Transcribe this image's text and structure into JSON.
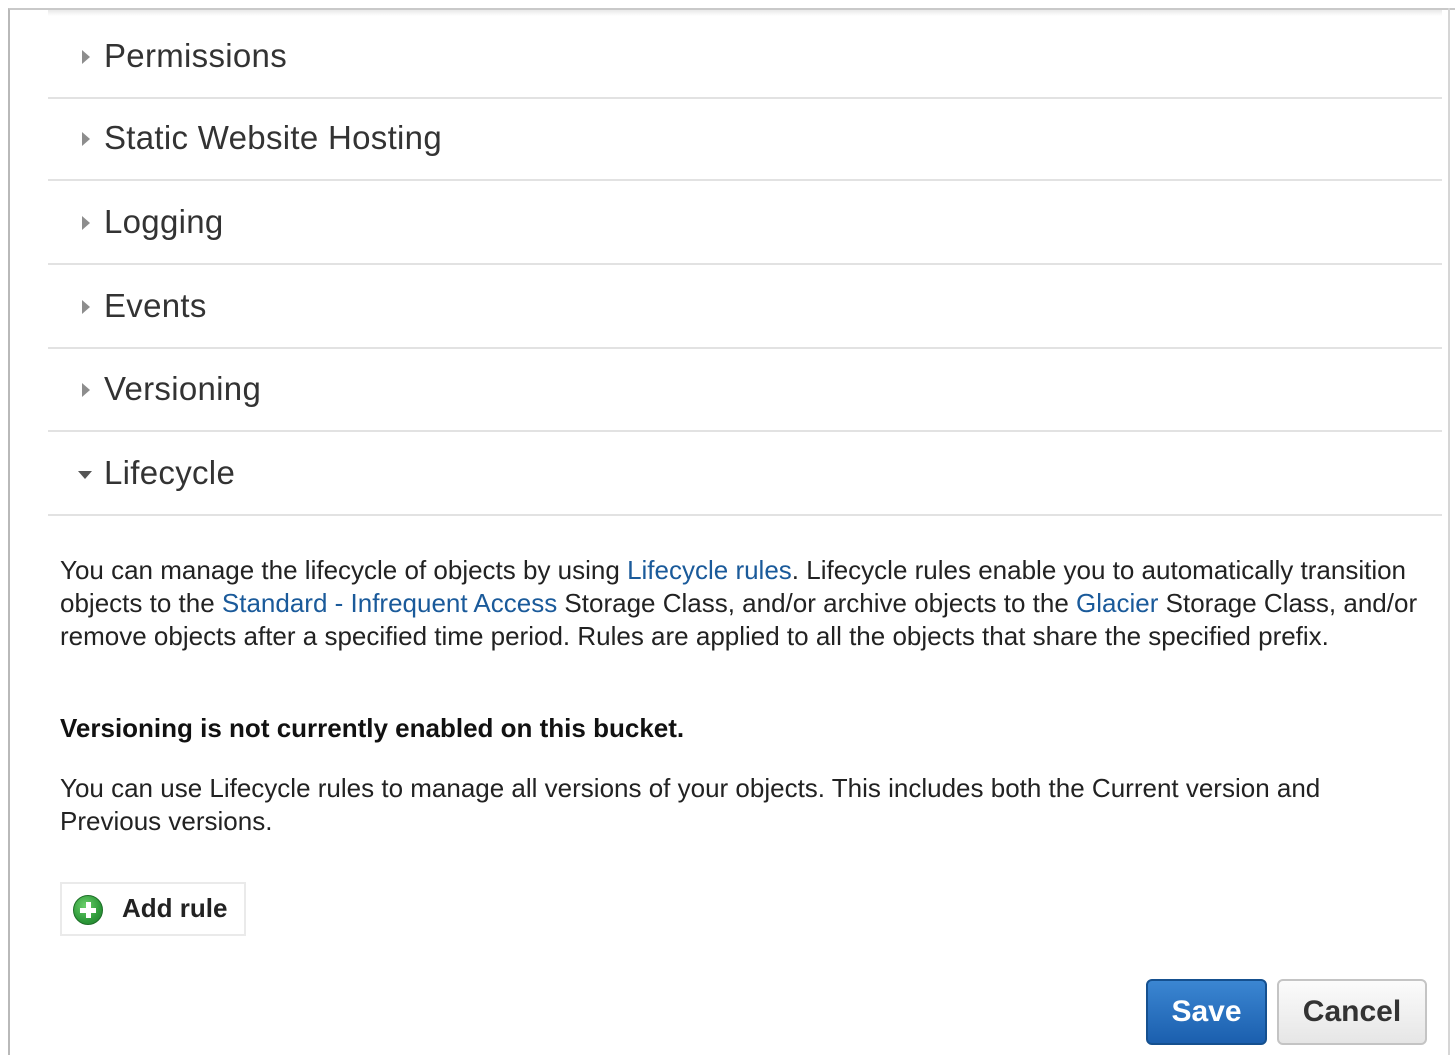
{
  "sections": [
    {
      "label": "Permissions",
      "expanded": false
    },
    {
      "label": "Static Website Hosting",
      "expanded": false
    },
    {
      "label": "Logging",
      "expanded": false
    },
    {
      "label": "Events",
      "expanded": false
    },
    {
      "label": "Versioning",
      "expanded": false
    },
    {
      "label": "Lifecycle",
      "expanded": true
    }
  ],
  "lifecycle": {
    "intro_1": "You can manage the lifecycle of objects by using ",
    "link_lifecycle_rules": "Lifecycle rules",
    "intro_2": ". Lifecycle rules enable you to automatically transition objects to the ",
    "link_standard_ia": "Standard - Infrequent Access",
    "intro_3": " Storage Class, and/or archive objects to the ",
    "link_glacier": "Glacier",
    "intro_4": " Storage Class, and/or remove objects after a specified time period. Rules are applied to all the objects that share the specified prefix.",
    "versioning_notice": "Versioning is not currently enabled on this bucket.",
    "versions_info": "You can use Lifecycle rules to manage all versions of your objects. This includes both the Current version and Previous versions.",
    "add_rule_label": "Add rule",
    "add_rule_icon": "plus-circle-icon"
  },
  "actions": {
    "save_label": "Save",
    "cancel_label": "Cancel"
  },
  "colors": {
    "link": "#1a5a9a",
    "save_button": "#1b5fae",
    "add_icon": "#2e9a3a"
  }
}
